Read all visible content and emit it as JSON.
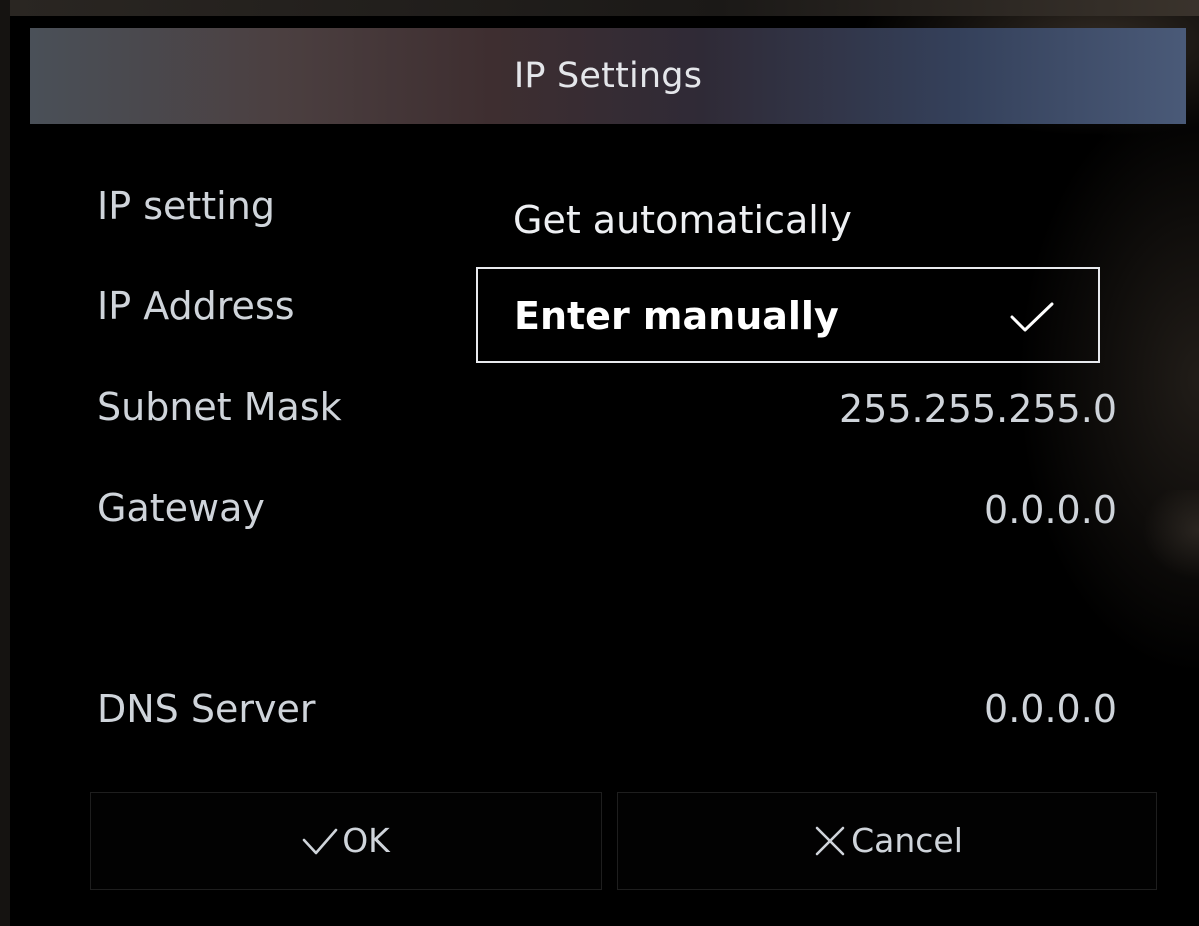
{
  "dialog": {
    "title": "IP Settings"
  },
  "rows": [
    {
      "label": "IP setting",
      "value": ""
    },
    {
      "label": "IP Address",
      "value": ""
    },
    {
      "label": "Subnet Mask",
      "value": "255.255.255.0"
    },
    {
      "label": "Gateway",
      "value": "0.0.0.0"
    },
    {
      "label": "DNS Server",
      "value": "0.0.0.0"
    }
  ],
  "ip_setting_options": {
    "auto": "Get automatically",
    "manual": "Enter manually",
    "selected": "Enter manually"
  },
  "buttons": {
    "ok": "OK",
    "cancel": "Cancel"
  },
  "icons": {
    "selected_check": "checkmark-icon",
    "ok": "checkmark-icon",
    "cancel": "x-icon"
  }
}
